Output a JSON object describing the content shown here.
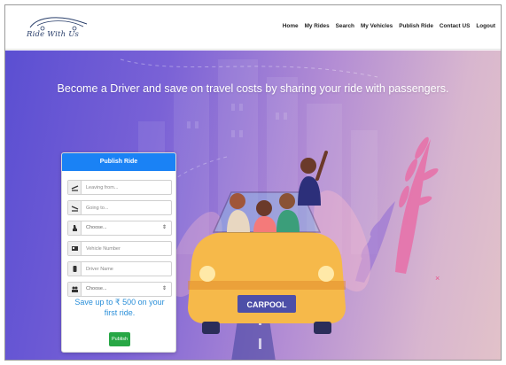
{
  "navbar": {
    "logo_text": "Ride With Us",
    "links": [
      "Home",
      "My Rides",
      "Search",
      "My Vehicles",
      "Publish Ride",
      "Contact US",
      "Logout"
    ]
  },
  "hero": {
    "headline": "Become a Driver and save on travel costs by sharing your ride with passengers.",
    "car_plate": "CARPOOL"
  },
  "form": {
    "title": "Publish Ride",
    "leaving_from": {
      "placeholder": "Leaving from...",
      "icon": "departure-icon"
    },
    "going_to": {
      "placeholder": "Going to...",
      "icon": "arrival-icon"
    },
    "vehicle_select": {
      "value": "Choose...",
      "icon": "car-seat-icon"
    },
    "vehicle_number": {
      "placeholder": "Vehicle Number",
      "icon": "id-card-icon"
    },
    "driver_name": {
      "placeholder": "Driver Name",
      "icon": "driver-icon"
    },
    "passengers_select": {
      "value": "Choose...",
      "icon": "users-icon"
    },
    "save_text": "Save up to ₹ 500 on your first ride.",
    "publish_label": "Publish"
  },
  "colors": {
    "primary_blue": "#1a82f5",
    "publish_green": "#27a745",
    "save_text_blue": "#2a8fd9"
  }
}
